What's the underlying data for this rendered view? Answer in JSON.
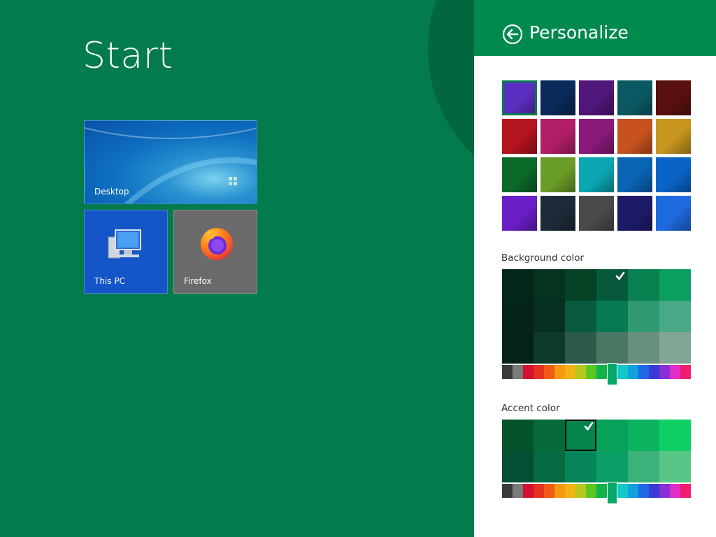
{
  "start": {
    "title": "Start"
  },
  "tiles": [
    {
      "label": "Desktop",
      "icon": "desktop-wallpaper"
    },
    {
      "label": "This PC",
      "icon": "computer-icon"
    },
    {
      "label": "Firefox",
      "icon": "firefox-icon"
    }
  ],
  "panel": {
    "title": "Personalize",
    "back_icon": "back-arrow-icon",
    "wallpapers": [
      "#5a2ec0",
      "#0a2a5a",
      "#51167a",
      "#0b5a63",
      "#5a1010",
      "#b4141e",
      "#b01e66",
      "#8a1a7a",
      "#c8521e",
      "#c8961e",
      "#0c6a28",
      "#6a9c28",
      "#0aa6b4",
      "#0a64b4",
      "#0a64c8",
      "#6a1ec8",
      "#1e2a3a",
      "#4a4a4a",
      "#1e1a6a",
      "#1e6ae0"
    ],
    "selected_wallpaper_index": 0,
    "background_color_label": "Background color",
    "accent_color_label": "Accent color",
    "background_swatches": [
      [
        "#032618",
        "#04331f",
        "#054226",
        "#06593a",
        "#08804f",
        "#0b9e5f"
      ],
      [
        "#042419",
        "#052f21",
        "#075a3d",
        "#087a52",
        "#2f9972",
        "#47a985"
      ],
      [
        "#052218",
        "#0d3a2a",
        "#2e5a4a",
        "#4b7765",
        "#69907f",
        "#83a596"
      ]
    ],
    "background_selected": [
      0,
      3
    ],
    "accent_swatches": [
      [
        "#04532b",
        "#056a37",
        "#07844b",
        "#08a15a",
        "#0bb35f",
        "#0fd064"
      ],
      [
        "#044e34",
        "#056a41",
        "#06845a",
        "#0b9e66",
        "#3cb27a",
        "#58c686"
      ]
    ],
    "accent_selected": [
      0,
      2
    ],
    "hue_colors": [
      "#3a3a3a",
      "#7a7a7a",
      "#d6102e",
      "#e0341e",
      "#f05a12",
      "#f49a12",
      "#f0b412",
      "#b4c81e",
      "#5ac81e",
      "#12b44a",
      "#12b49a",
      "#12c8c8",
      "#12a0e0",
      "#1e6ae0",
      "#3a3ad6",
      "#8a2ed6",
      "#e02ec8",
      "#f01e6e"
    ],
    "hue_selected_index": 10
  }
}
